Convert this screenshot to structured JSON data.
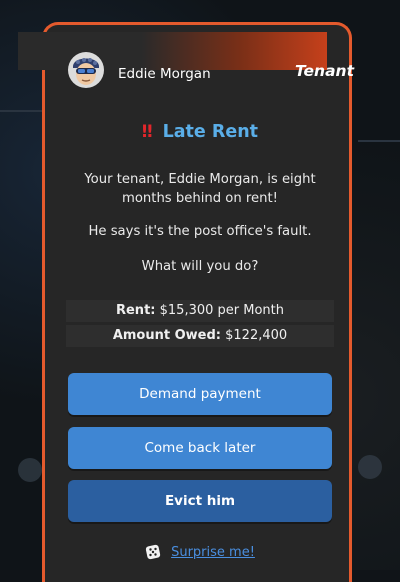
{
  "header": {
    "name": "Eddie Morgan",
    "role": "Tenant"
  },
  "event": {
    "icon": "double-exclamation-icon",
    "title": "Late Rent",
    "message_1": "Your tenant, Eddie Morgan, is eight months behind on rent!",
    "message_2": "He says it's the post office's fault.",
    "message_3": "What will you do?"
  },
  "details": {
    "rent_label": "Rent:",
    "rent_value": "$15,300 per Month",
    "owed_label": "Amount Owed:",
    "owed_value": "$122,400"
  },
  "actions": {
    "demand": "Demand payment",
    "later": "Come back later",
    "evict": "Evict him",
    "surprise": "Surprise me!"
  },
  "colors": {
    "accent": "#e45a2d",
    "title": "#5aaee8",
    "button": "#3f86d3",
    "button_dark": "#2b5fa0",
    "link": "#4a8fe0"
  }
}
